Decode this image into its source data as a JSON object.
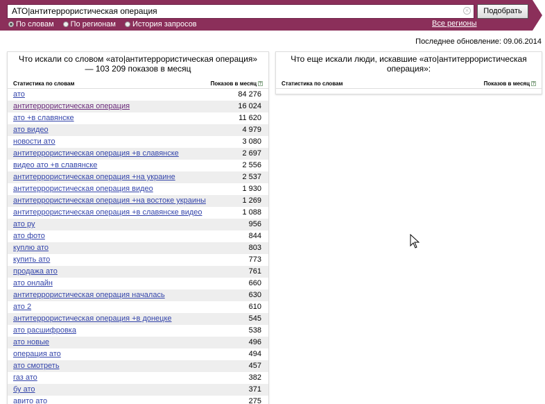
{
  "search": {
    "query": "АТО|антитеррористическая операция",
    "button_label": "Подобрать",
    "radios": [
      {
        "label": "По словам",
        "selected": true
      },
      {
        "label": "По регионам",
        "selected": false
      },
      {
        "label": "История запросов",
        "selected": false
      }
    ],
    "regions_link": "Все регионы"
  },
  "last_update": "Последнее обновление: 09.06.2014",
  "left_panel": {
    "title": "Что искали со словом «ато|антитеррористическая операция» — 103 209 показов в месяц",
    "col_words": "Статистика по словам",
    "col_count": "Показов в месяц",
    "rows": [
      {
        "phrase": "ато",
        "count": "84 276"
      },
      {
        "phrase": "антитеррористическая операция",
        "count": "16 024"
      },
      {
        "phrase": "ато +в славянске",
        "count": "11 620"
      },
      {
        "phrase": "ато видео",
        "count": "4 979"
      },
      {
        "phrase": "новости ато",
        "count": "3 080"
      },
      {
        "phrase": "антитеррористическая операция +в славянске",
        "count": "2 697"
      },
      {
        "phrase": "видео ато +в славянске",
        "count": "2 556"
      },
      {
        "phrase": "антитеррористическая операция +на украине",
        "count": "2 537"
      },
      {
        "phrase": "антитеррористическая операция видео",
        "count": "1 930"
      },
      {
        "phrase": "антитеррористическая операция +на востоке украины",
        "count": "1 269"
      },
      {
        "phrase": "антитеррористическая операция +в славянске видео",
        "count": "1 088"
      },
      {
        "phrase": "ато ру",
        "count": "956"
      },
      {
        "phrase": "ато фото",
        "count": "844"
      },
      {
        "phrase": "куплю ато",
        "count": "803"
      },
      {
        "phrase": "купить ато",
        "count": "773"
      },
      {
        "phrase": "продажа ато",
        "count": "761"
      },
      {
        "phrase": "ато онлайн",
        "count": "660"
      },
      {
        "phrase": "антитеррористическая операция началась",
        "count": "630"
      },
      {
        "phrase": "ато 2",
        "count": "610"
      },
      {
        "phrase": "антитеррористическая операция +в донецке",
        "count": "545"
      },
      {
        "phrase": "ато расшифровка",
        "count": "538"
      },
      {
        "phrase": "ато новые",
        "count": "496"
      },
      {
        "phrase": "операция ато",
        "count": "494"
      },
      {
        "phrase": "ато смотреть",
        "count": "457"
      },
      {
        "phrase": "газ ато",
        "count": "382"
      },
      {
        "phrase": "бу ато",
        "count": "371"
      },
      {
        "phrase": "авито ато",
        "count": "275"
      }
    ]
  },
  "right_panel": {
    "title": "Что еще искали люди, искавшие «ато|антитеррористическая операция»:",
    "col_words": "Статистика по словам",
    "col_count": "Показов в месяц"
  },
  "help_mark": "?",
  "colors": {
    "bar": "#8b2f5a",
    "link": "#3344aa",
    "visited": "#6a2a7a"
  }
}
